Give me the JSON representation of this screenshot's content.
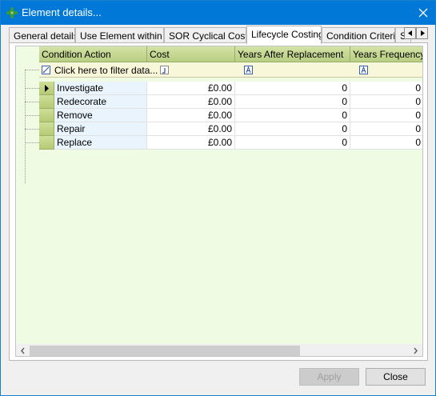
{
  "window": {
    "title": "Element details..."
  },
  "tabs": [
    {
      "label": "General details"
    },
    {
      "label": "Use Element within .."
    },
    {
      "label": "SOR Cyclical Costs"
    },
    {
      "label": "Lifecycle Costing"
    },
    {
      "label": "Condition Criteria"
    },
    {
      "label": "S"
    }
  ],
  "active_tab": "Lifecycle Costing",
  "grid": {
    "columns": [
      "Condition Action",
      "Cost",
      "Years After Replacement",
      "Years Frequency"
    ],
    "filter_placeholder": "Click here to filter data...",
    "rows": [
      {
        "action": "Investigate",
        "cost": "£0.00",
        "years_after": "0",
        "frequency": "0"
      },
      {
        "action": "Redecorate",
        "cost": "£0.00",
        "years_after": "0",
        "frequency": "0"
      },
      {
        "action": "Remove",
        "cost": "£0.00",
        "years_after": "0",
        "frequency": "0"
      },
      {
        "action": "Repair",
        "cost": "£0.00",
        "years_after": "0",
        "frequency": "0"
      },
      {
        "action": "Replace",
        "cost": "£0.00",
        "years_after": "0",
        "frequency": "0"
      }
    ],
    "selected_row": 0
  },
  "buttons": {
    "apply": "Apply",
    "close": "Close"
  },
  "colors": {
    "titlebar": "#0078d7",
    "grid_header": "#c6d890",
    "filter_row": "#f9f7d9",
    "grid_background": "#f0fbe4"
  }
}
